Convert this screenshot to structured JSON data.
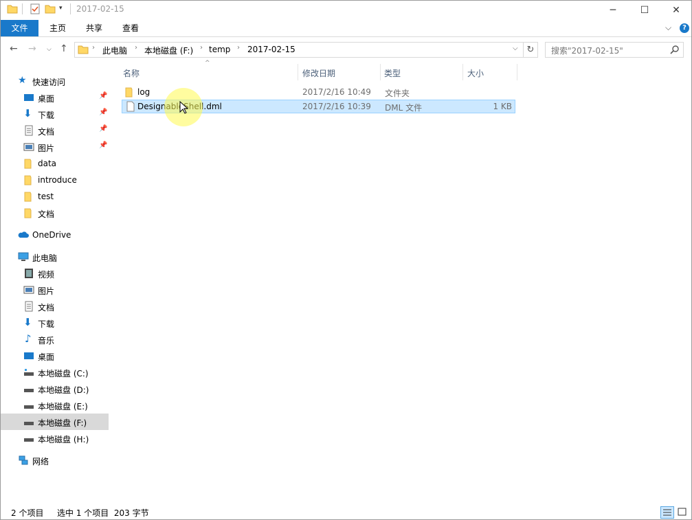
{
  "window": {
    "title": "2017-02-15"
  },
  "ribbon": {
    "tabs": [
      "文件",
      "主页",
      "共享",
      "查看"
    ]
  },
  "address": {
    "crumbs": [
      "此电脑",
      "本地磁盘 (F:)",
      "temp",
      "2017-02-15"
    ]
  },
  "search": {
    "placeholder": "搜索\"2017-02-15\""
  },
  "nav": {
    "quick_access": "快速访问",
    "quick_items": [
      "桌面",
      "下载",
      "文档",
      "图片",
      "data",
      "introduce",
      "test",
      "文档"
    ],
    "onedrive": "OneDrive",
    "this_pc": "此电脑",
    "pc_items": [
      "视频",
      "图片",
      "文档",
      "下载",
      "音乐",
      "桌面",
      "本地磁盘 (C:)",
      "本地磁盘 (D:)",
      "本地磁盘 (E:)",
      "本地磁盘 (F:)",
      "本地磁盘 (H:)"
    ],
    "network": "网络"
  },
  "columns": [
    "名称",
    "修改日期",
    "类型",
    "大小"
  ],
  "files": [
    {
      "name": "log",
      "date": "2017/2/16 10:49",
      "type": "文件夹",
      "size": ""
    },
    {
      "name": "DesignableShell.dml",
      "date": "2017/2/16 10:39",
      "type": "DML 文件",
      "size": "1 KB"
    }
  ],
  "status": {
    "count": "2 个项目",
    "selected": "选中 1 个项目  203 字节"
  },
  "colors": {
    "accent": "#1979ca",
    "folder": "#ffd866",
    "selection": "#cce8ff"
  }
}
